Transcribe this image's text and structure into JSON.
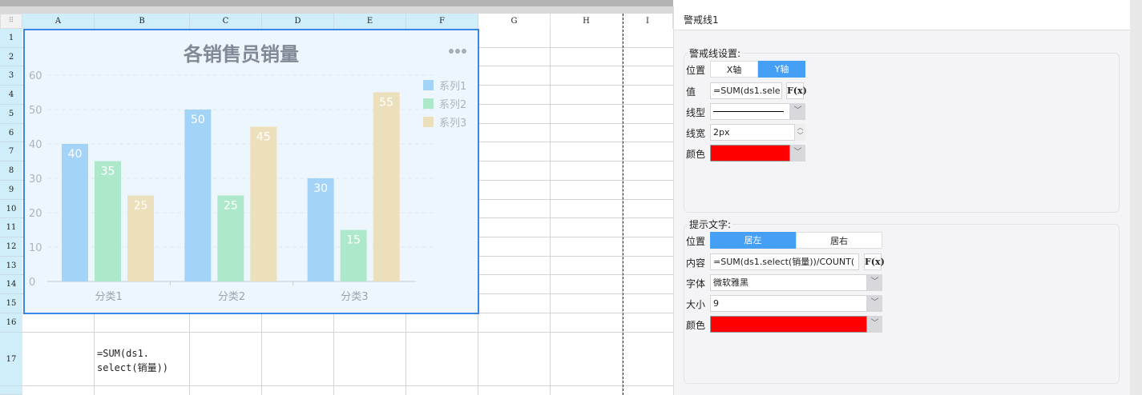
{
  "sheet": {
    "columns": [
      "A",
      "B",
      "C",
      "D",
      "E",
      "F",
      "G",
      "H",
      "I"
    ],
    "rows": [
      "1",
      "2",
      "3",
      "4",
      "5",
      "6",
      "7",
      "8",
      "9",
      "10",
      "11",
      "12",
      "13",
      "14",
      "15",
      "16",
      "17"
    ],
    "cell_b17": "=SUM(ds1.\nselect(销量))"
  },
  "chart_data": {
    "type": "bar",
    "title": "各销售员销量",
    "categories": [
      "分类1",
      "分类2",
      "分类3"
    ],
    "series": [
      {
        "name": "系列1",
        "values": [
          40,
          50,
          30
        ],
        "color": "#a3d3f7"
      },
      {
        "name": "系列2",
        "values": [
          35,
          25,
          15
        ],
        "color": "#aee8cb"
      },
      {
        "name": "系列3",
        "values": [
          25,
          45,
          55
        ],
        "color": "#ecdfbc"
      }
    ],
    "yticks": [
      "0",
      "10",
      "20",
      "30",
      "40",
      "50",
      "60"
    ],
    "ylim": [
      0,
      60
    ],
    "grid": true,
    "legend": "right",
    "menu_icon": "more-dots"
  },
  "panel": {
    "title": "警戒线1",
    "warning": {
      "legend": "警戒线设置:",
      "position_label": "位置",
      "pos_x": "X轴",
      "pos_y": "Y轴",
      "selected": "Y轴",
      "value_label": "值",
      "value": "=SUM(ds1.sele",
      "linetype_label": "线型",
      "linewidth_label": "线宽",
      "linewidth": "2px",
      "color_label": "颜色",
      "color": "#ff0000",
      "fx": "F(x)"
    },
    "tip": {
      "legend": "提示文字:",
      "position_label": "位置",
      "left": "居左",
      "right": "居右",
      "selected": "居左",
      "content_label": "内容",
      "content": "=SUM(ds1.select(销量))/COUNT(",
      "font_label": "字体",
      "font": "微软雅黑",
      "size_label": "大小",
      "size": "9",
      "color_label": "颜色",
      "color": "#ff0000",
      "fx": "F(x)"
    }
  }
}
